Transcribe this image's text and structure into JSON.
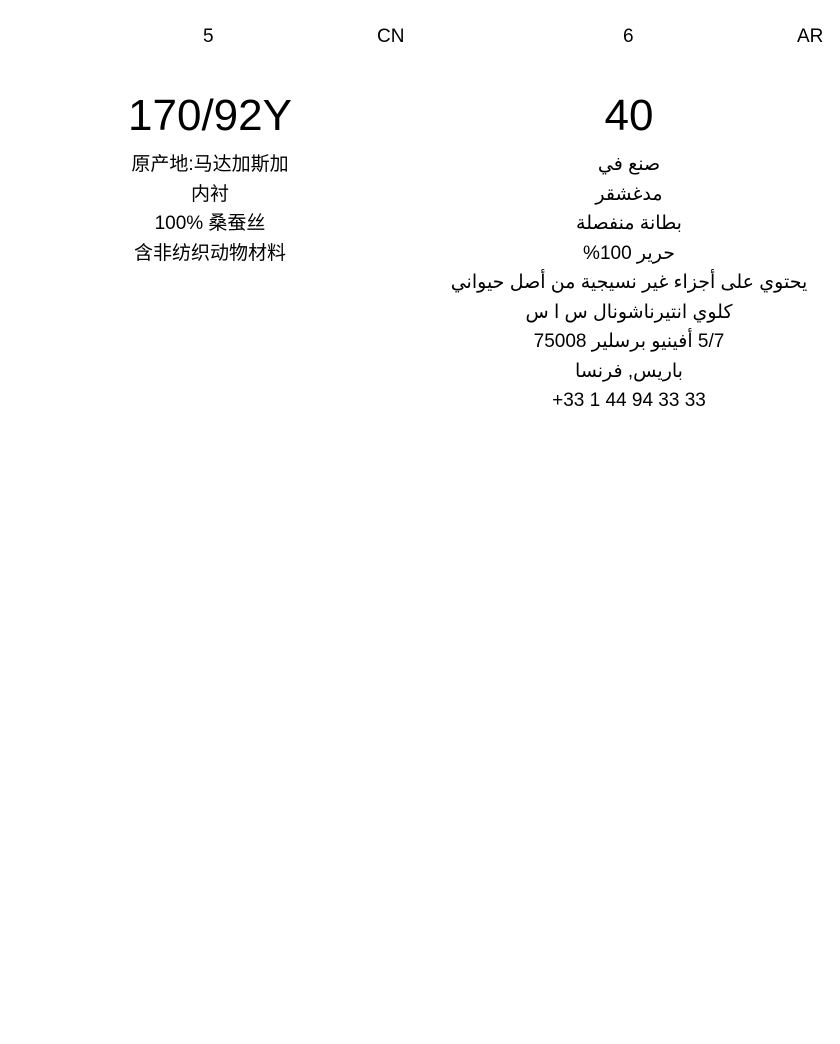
{
  "header": {
    "left_number": "5",
    "left_code": "CN",
    "right_number": "6",
    "right_code": "AR"
  },
  "cn": {
    "size": "170/92Y",
    "origin": "原产地:马达加斯加",
    "lining_label": "内衬",
    "lining_fabric": "100% 桑蚕丝",
    "notice": "含非纺织动物材料"
  },
  "ar": {
    "size": "40",
    "made_in": "صنع في",
    "country": "مدغشقر",
    "lining_label": "بطانة منفصلة",
    "lining_fabric": "حرير 100%",
    "notice": "يحتوي على أجزاء غير نسيجية من أصل حيواني",
    "company": "كلوي انتيرناشونال س ا س",
    "street": "5/7 أفينيو  برسلير 75008",
    "city": "باريس, فرنسا",
    "phone": "+33 1 44 94 33 33"
  }
}
